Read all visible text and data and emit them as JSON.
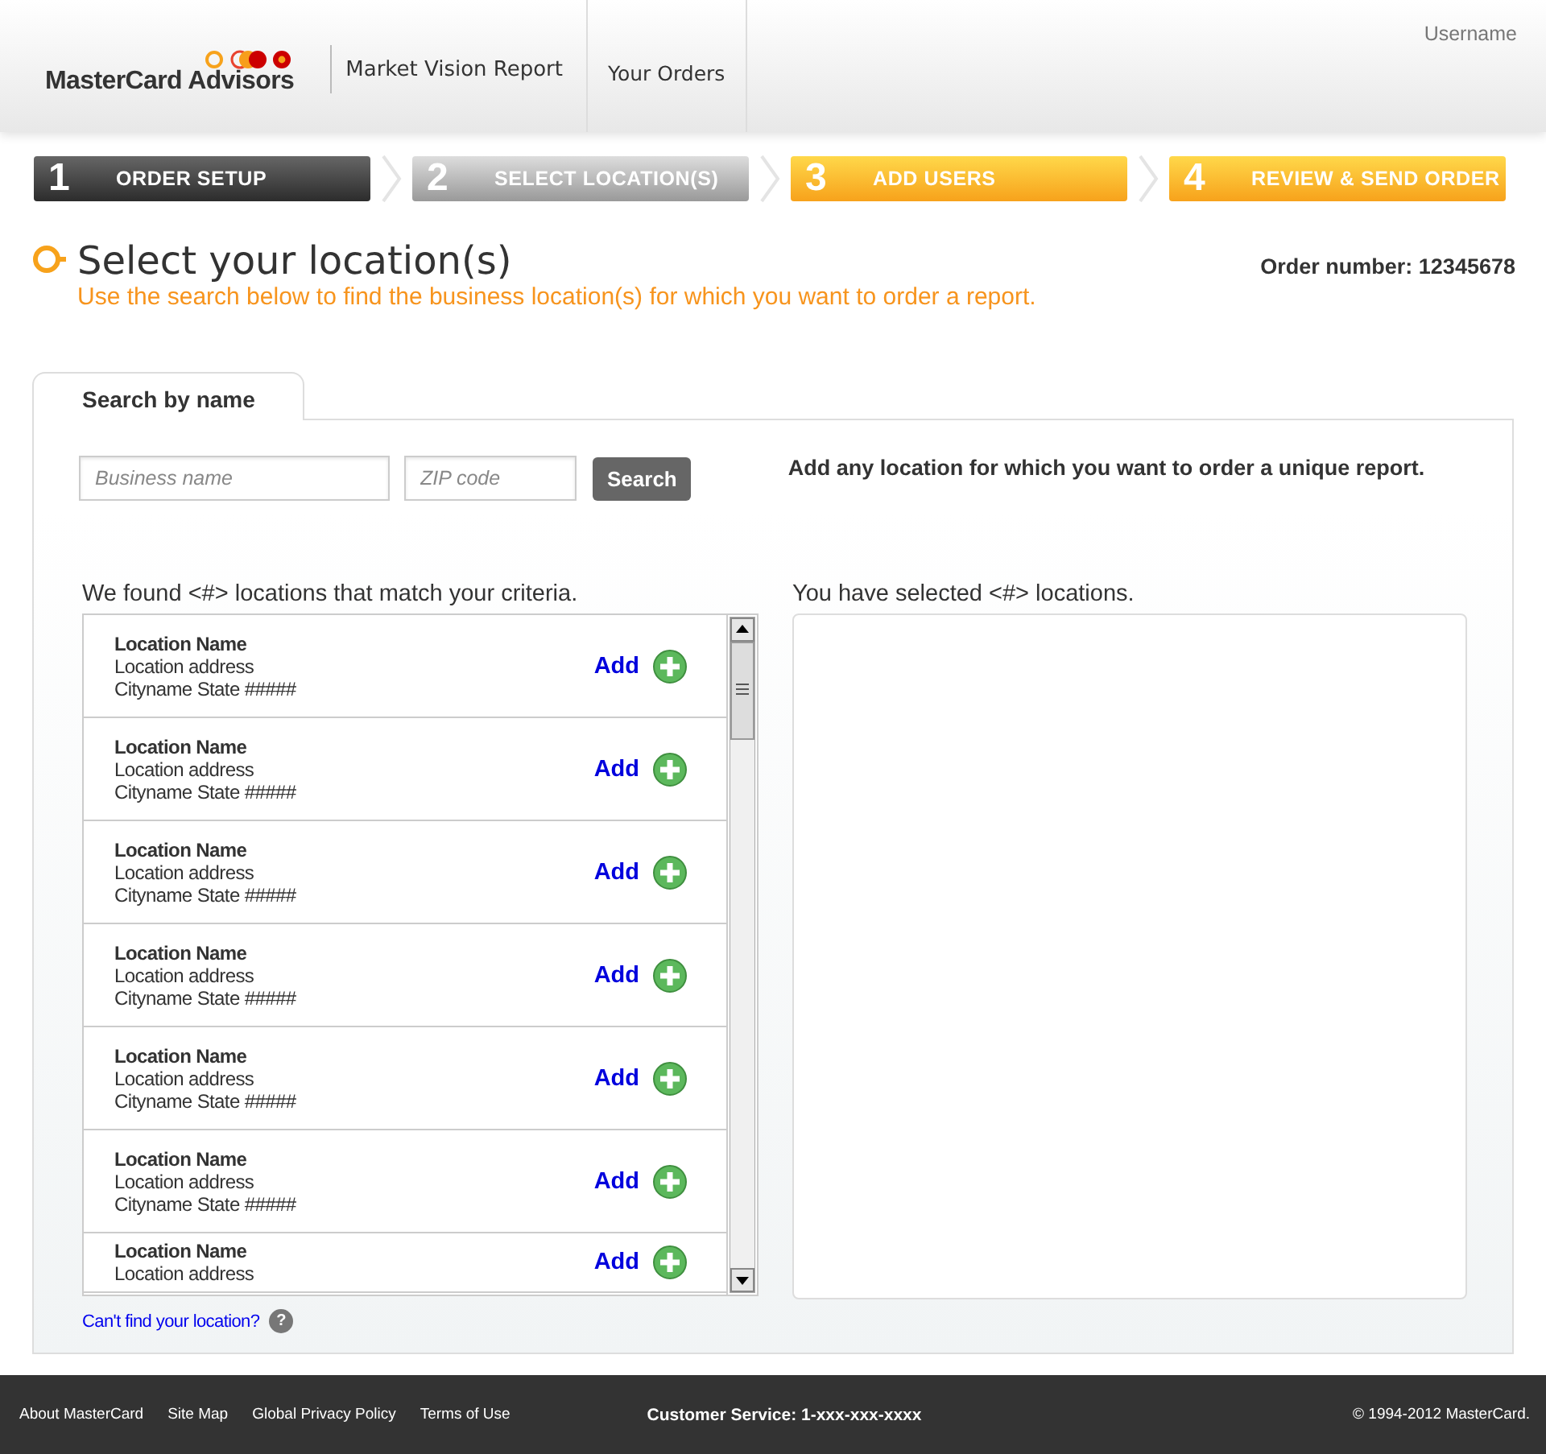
{
  "header": {
    "brand": "MasterCard Advisors",
    "product": "Market Vision Report",
    "nav": [
      {
        "label": "Your Orders"
      }
    ],
    "user": "Username"
  },
  "steps": [
    {
      "number": "1",
      "label": "ORDER SETUP",
      "kind": "dark"
    },
    {
      "number": "2",
      "label": "SELECT LOCATION(S)",
      "kind": "grey"
    },
    {
      "number": "3",
      "label": "ADD USERS",
      "kind": "orange"
    },
    {
      "number": "4",
      "label": "REVIEW & SEND ORDER",
      "kind": "orange"
    }
  ],
  "page": {
    "title": "Select your location(s)",
    "subtitle": "Use the search below to find the business location(s) for which you want to order a report.",
    "order_number": "Order number: 12345678"
  },
  "tabs": [
    {
      "label": "Search by name",
      "selected": true
    }
  ],
  "search": {
    "name_placeholder": "Business name",
    "zip_placeholder": "ZIP code",
    "button": "Search",
    "hint": "Add any location for which you want to order a unique report."
  },
  "results": {
    "heading": "We found <#> locations that match your criteria.",
    "items": [
      {
        "name": "Location Name",
        "address": "Location address",
        "city": "Cityname State  #####",
        "action": "Add"
      },
      {
        "name": "Location Name",
        "address": "Location address",
        "city": "Cityname State  #####",
        "action": "Add"
      },
      {
        "name": "Location Name",
        "address": "Location address",
        "city": "Cityname State  #####",
        "action": "Add"
      },
      {
        "name": "Location Name",
        "address": "Location address",
        "city": "Cityname State  #####",
        "action": "Add"
      },
      {
        "name": "Location Name",
        "address": "Location address",
        "city": "Cityname State  #####",
        "action": "Add"
      },
      {
        "name": "Location Name",
        "address": "Location address",
        "city": "Cityname State  #####",
        "action": "Add"
      },
      {
        "name": "Location Name",
        "address": "Location address",
        "action": "Add"
      }
    ],
    "help_link": "Can't find your location?",
    "help_icon": "?"
  },
  "selected": {
    "heading": "You have selected <#> locations."
  },
  "footer": {
    "links": [
      "About MasterCard",
      "Site Map",
      "Global Privacy Policy",
      "Terms of Use"
    ],
    "service": "Customer Service: 1-xxx-xxx-xxxx",
    "copyright": "© 1994-2012 MasterCard."
  }
}
